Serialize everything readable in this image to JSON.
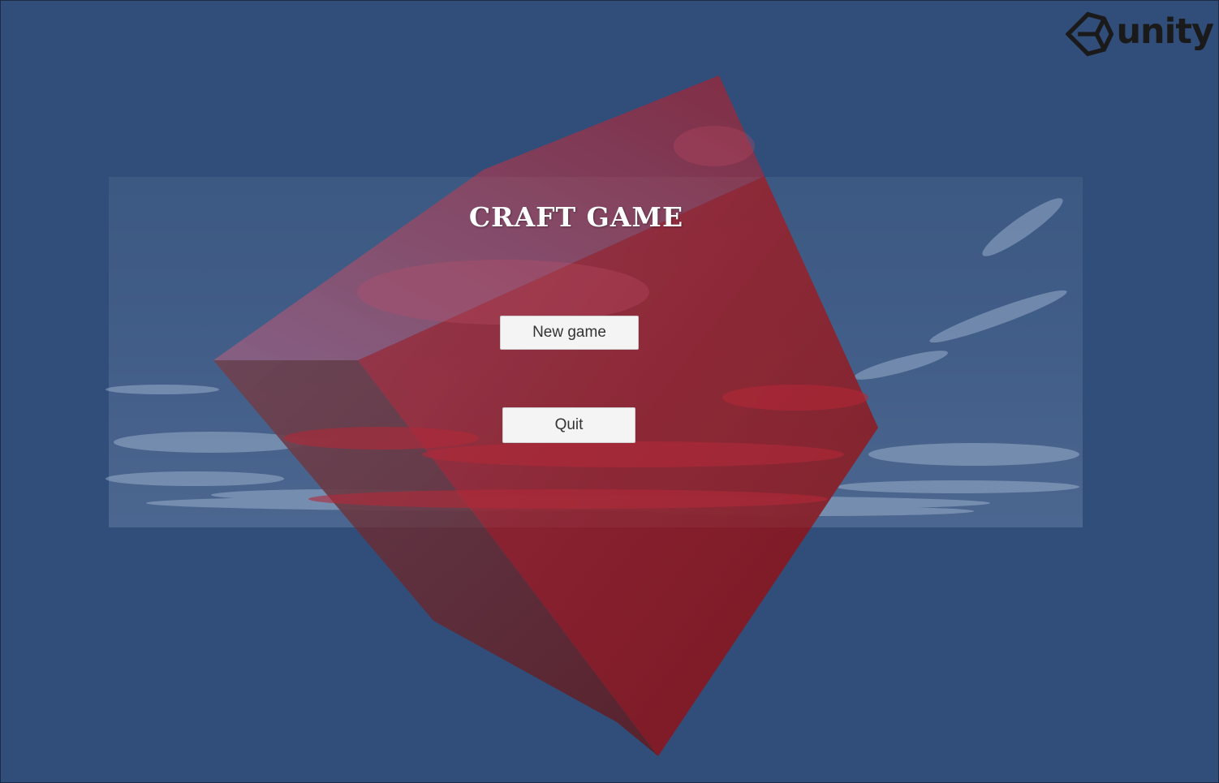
{
  "game": {
    "title": "CRAFT GAME"
  },
  "menu": {
    "new_game_label": "New game",
    "quit_label": "Quit"
  },
  "branding": {
    "engine_logo_text": "unity",
    "engine_logo_icon": "unity-cube-icon"
  },
  "colors": {
    "background": "#314e7a",
    "cube": "#8c1c24",
    "button": "#f4f4f4",
    "title": "#ffffff"
  }
}
